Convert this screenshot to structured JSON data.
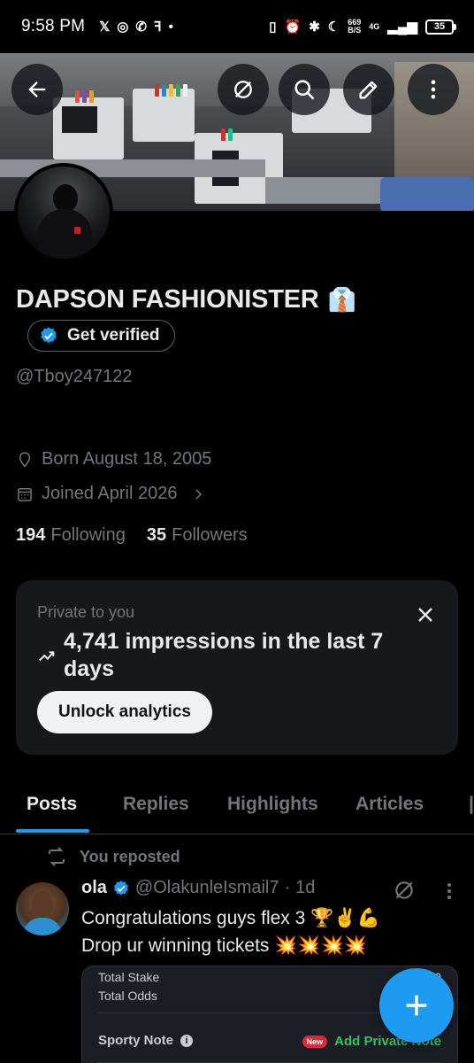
{
  "status_bar": {
    "time": "9:58 PM",
    "net_speed_value": "669",
    "net_speed_unit": "B/S",
    "network": "4G",
    "battery": "35"
  },
  "profile": {
    "name": "DAPSON FASHIONISTER",
    "name_emoji": "👔",
    "verify_label": "Get verified",
    "handle": "@Tboy247122",
    "born": "Born August 18, 2005",
    "joined": "Joined April 2026",
    "following_count": "194",
    "following_label": "Following",
    "followers_count": "35",
    "followers_label": "Followers"
  },
  "analytics_card": {
    "private_label": "Private to you",
    "impressions_line1": "4,741 impressions in the last 7",
    "impressions_line2": "days",
    "unlock_label": "Unlock analytics"
  },
  "tabs": [
    {
      "label": "Posts",
      "active": true
    },
    {
      "label": "Replies",
      "active": false
    },
    {
      "label": "Highlights",
      "active": false
    },
    {
      "label": "Articles",
      "active": false
    }
  ],
  "post": {
    "repost_label": "You reposted",
    "author_name": "ola",
    "author_handle": "@OlakunleIsmail7",
    "separator": "·",
    "time": "1d",
    "text_line1": "Congratulations guys flex 3 🏆✌️💪",
    "text_line2": "Drop ur winning tickets 💥💥💥💥",
    "media": {
      "row1_label": "Total Stake",
      "row1_value": "1",
      "row1_value_end": "0",
      "row2_label": "Total Odds",
      "note_label": "Sporty Note",
      "new_badge": "New",
      "add_note_label": "Add Private Note"
    }
  },
  "colors": {
    "accent": "#1d9bf0",
    "background": "#000000",
    "secondary_text": "#71767b",
    "card_bg": "#16181c"
  },
  "icons": [
    "back-arrow-icon",
    "grok-icon",
    "search-icon",
    "edit-icon",
    "more-vertical-icon",
    "verified-badge-icon",
    "location-icon",
    "calendar-icon",
    "chevron-right-icon",
    "close-icon",
    "trend-up-icon",
    "repost-icon",
    "plus-icon"
  ]
}
